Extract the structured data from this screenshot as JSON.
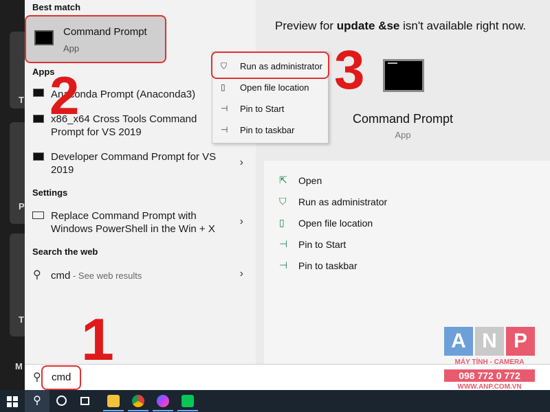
{
  "left_strip": {
    "tile_letters": [
      "T",
      "T",
      "P",
      "T"
    ],
    "bottom_letter": "M"
  },
  "results": {
    "best_match_header": "Best match",
    "best_match": {
      "title": "Command Prompt",
      "subtitle": "App"
    },
    "apps_header": "Apps",
    "apps": [
      {
        "label": "Anaconda Prompt (Anaconda3)"
      },
      {
        "label": "x86_x64 Cross Tools Command Prompt for VS 2019"
      },
      {
        "label": "Developer Command Prompt for VS 2019"
      }
    ],
    "settings_header": "Settings",
    "settings": [
      {
        "label": "Replace Command Prompt with Windows PowerShell in the Win + X"
      }
    ],
    "web_header": "Search the web",
    "web": {
      "query": "cmd",
      "suffix": " - See web results"
    }
  },
  "context_menu": {
    "items": [
      {
        "label": "Run as administrator",
        "icon": "shield-icon"
      },
      {
        "label": "Open file location",
        "icon": "folder-icon"
      },
      {
        "label": "Pin to Start",
        "icon": "pin-icon"
      },
      {
        "label": "Pin to taskbar",
        "icon": "pin-icon"
      }
    ]
  },
  "preview": {
    "message_prefix": "Preview for ",
    "message_bold": "update &se",
    "message_suffix": " isn't available right now.",
    "app_title": "Command Prompt",
    "app_subtitle": "App",
    "actions": [
      {
        "label": "Open",
        "icon": "open-icon"
      },
      {
        "label": "Run as administrator",
        "icon": "shield-icon"
      },
      {
        "label": "Open file location",
        "icon": "folder-icon"
      },
      {
        "label": "Pin to Start",
        "icon": "pin-icon"
      },
      {
        "label": "Pin to taskbar",
        "icon": "pin-icon"
      }
    ]
  },
  "search": {
    "value": "cmd",
    "icon": "search-icon"
  },
  "annotations": {
    "step1": "1",
    "step2": "2",
    "step3": "3",
    "color": "#e01a1a"
  },
  "watermark": {
    "letters": [
      "A",
      "N",
      "P"
    ],
    "tagline": "MÁY TÍNH - CAMERA",
    "phone": "098 772 0 772",
    "url": "WWW.ANP.COM.VN"
  },
  "taskbar": {
    "icons": [
      "windows-icon",
      "search-icon",
      "cortana-icon",
      "task-view-icon",
      "file-explorer-icon",
      "chrome-icon",
      "messenger-icon",
      "line-icon"
    ]
  },
  "colors": {
    "highlight": "#e03131",
    "accent": "#1e8a4b",
    "taskbar": "#1b2530"
  }
}
